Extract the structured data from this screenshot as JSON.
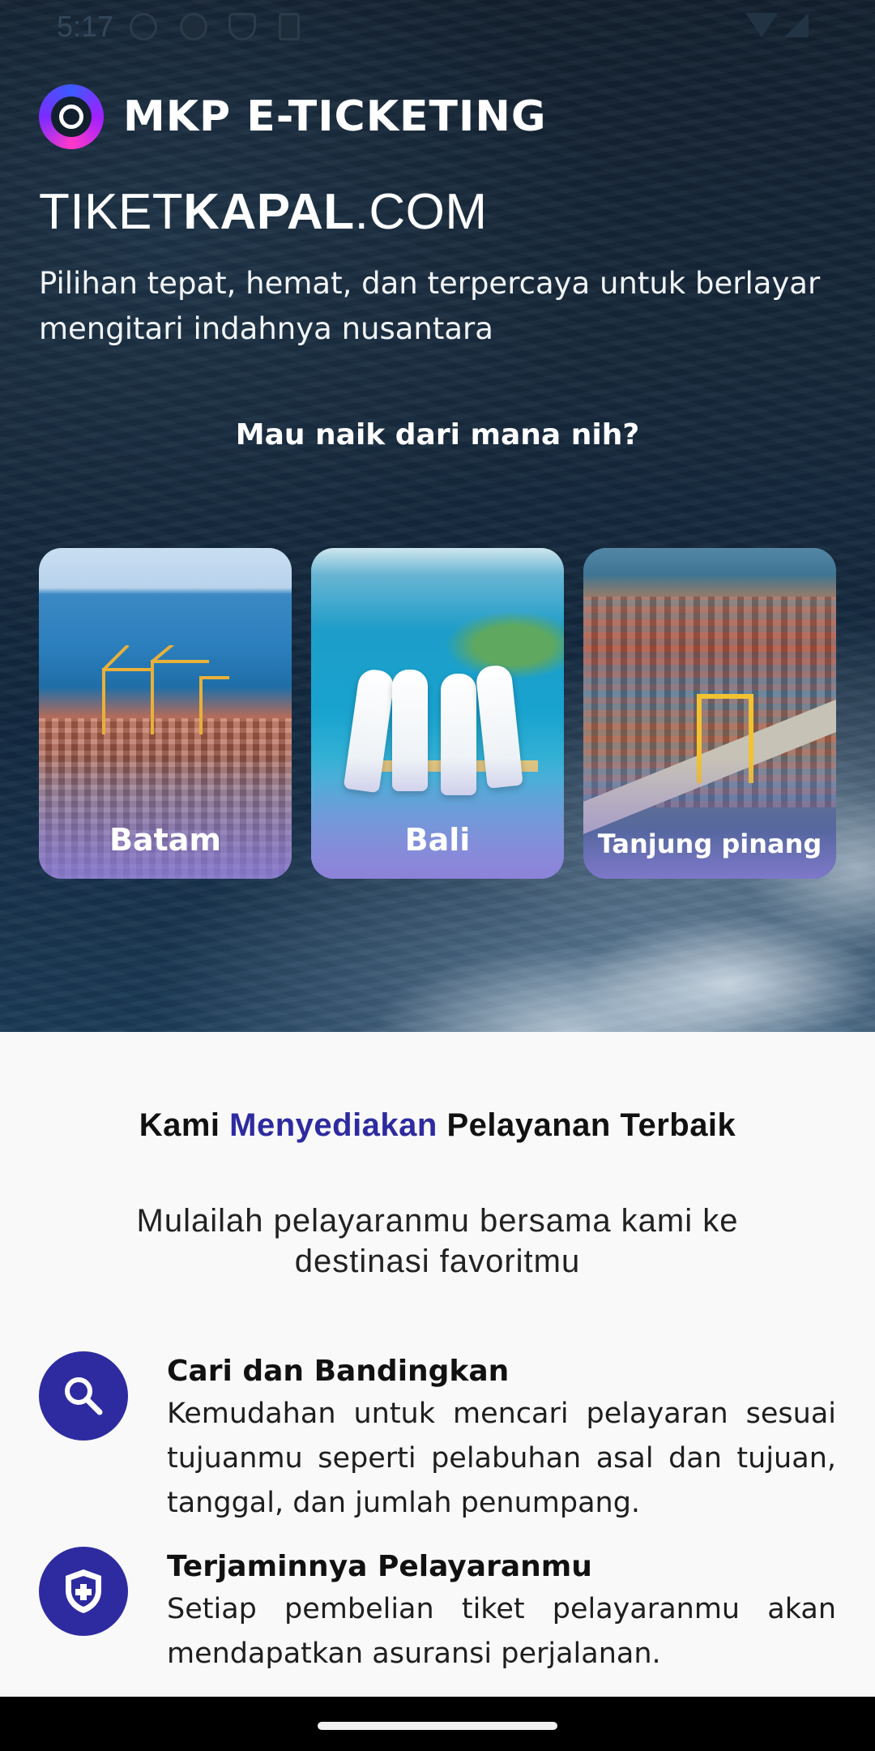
{
  "status_bar": {
    "time": "5:17"
  },
  "hero": {
    "brand_name": "MKP E-TICKETING",
    "site_title_prefix": "TIKET",
    "site_title_bold": "KAPAL",
    "site_title_suffix": ".COM",
    "tagline": "Pilihan tepat, hemat, dan terpercaya untuk berlayar mengitari indahnya nusantara",
    "question": "Mau naik dari mana nih?",
    "destinations": [
      {
        "label": "Batam"
      },
      {
        "label": "Bali"
      },
      {
        "label": "Tanjung pinang"
      }
    ]
  },
  "features": {
    "title_part1": "Kami ",
    "title_accent": "Menyediakan",
    "title_part2": " Pelayanan Terbaik",
    "subtitle": "Mulailah pelayaranmu bersama kami ke destinasi favoritmu",
    "items": [
      {
        "icon": "search-icon",
        "title": "Cari dan Bandingkan",
        "description": "Kemudahan untuk mencari pelayaran sesuai tujuanmu seperti pelabuhan asal dan tujuan, tanggal, dan jumlah penumpang."
      },
      {
        "icon": "shield-plus-icon",
        "title": "Terjaminnya Pelayaranmu",
        "description": "Setiap pembelian tiket pelayaranmu akan mendapatkan asuransi perjalanan."
      }
    ]
  },
  "colors": {
    "accent": "#2e2ba0",
    "hero_dark": "#13202e",
    "card_overlay": "#8c7dd7"
  }
}
